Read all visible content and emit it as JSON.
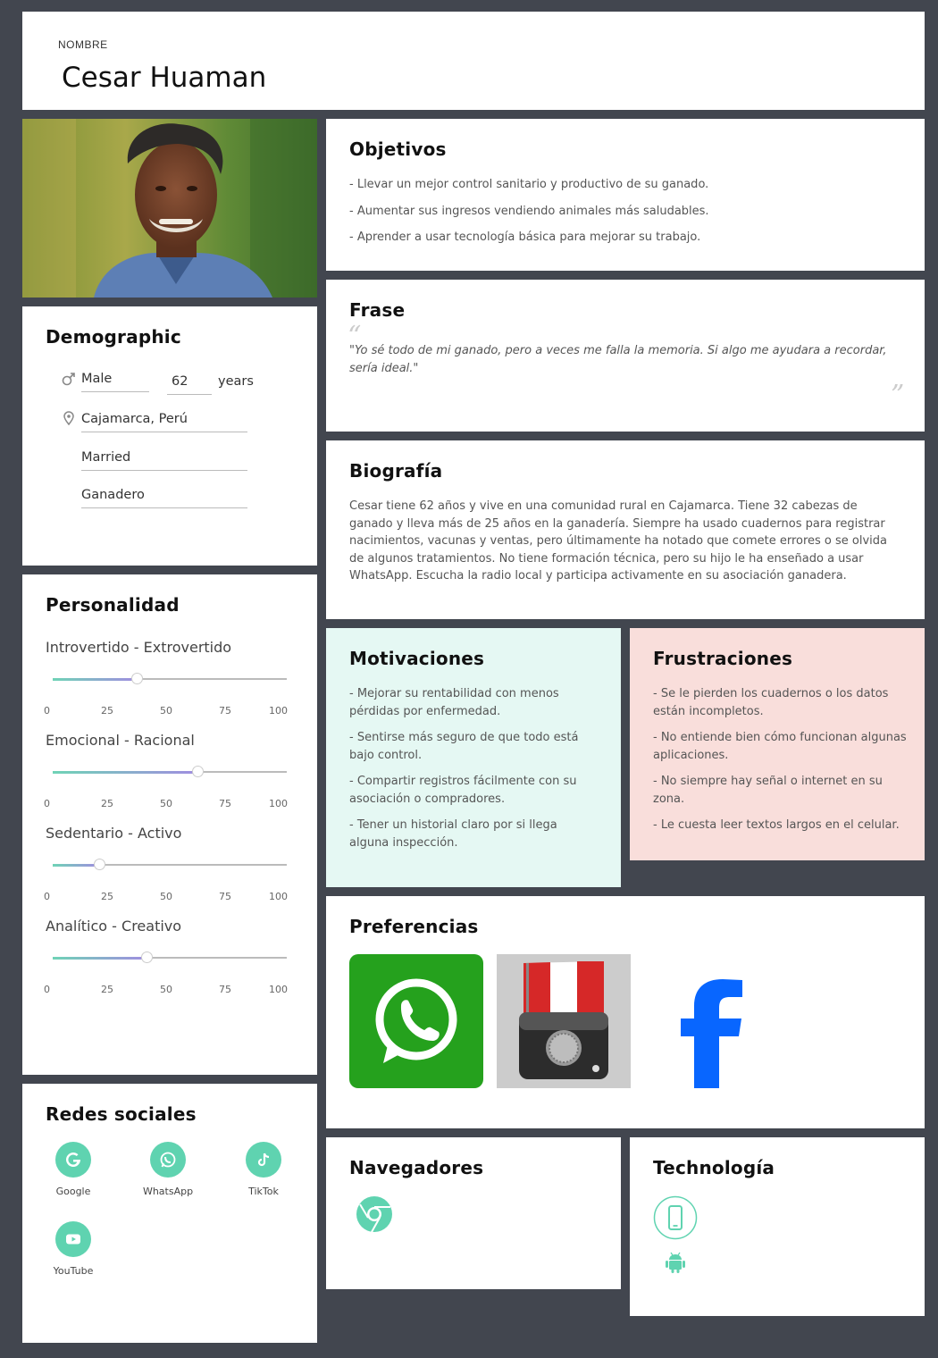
{
  "header": {
    "label": "NOMBRE",
    "name": "Cesar Huaman"
  },
  "demographic": {
    "title": "Demographic",
    "gender": "Male",
    "age": "62",
    "age_unit": "years",
    "location": "Cajamarca, Perú",
    "status": "Married",
    "occupation": "Ganadero"
  },
  "personality": {
    "title": "Personalidad",
    "ticks": [
      "0",
      "25",
      "50",
      "75",
      "100"
    ],
    "traits": [
      {
        "label": "Introvertido - Extrovertido",
        "value": 36
      },
      {
        "label": "Emocional - Racional",
        "value": 62
      },
      {
        "label": "Sedentario - Activo",
        "value": 20
      },
      {
        "label": "Analítico - Creativo",
        "value": 40
      }
    ]
  },
  "social": {
    "title": "Redes sociales",
    "items": [
      "Google",
      "WhatsApp",
      "TikTok",
      "YouTube"
    ]
  },
  "objectives": {
    "title": "Objetivos",
    "items": [
      "- Llevar un mejor control sanitario y productivo de su ganado.",
      "- Aumentar sus ingresos vendiendo animales más saludables.",
      "- Aprender a usar tecnología básica para mejorar su trabajo."
    ]
  },
  "quote": {
    "title": "Frase",
    "text": "\"Yo sé todo de mi ganado, pero a veces me falla la memoria. Si algo me ayudara a recordar, sería ideal.\""
  },
  "bio": {
    "title": "Biografía",
    "text": "Cesar tiene 62 años y vive en una comunidad rural en Cajamarca. Tiene 32 cabezas de ganado y lleva más de 25 años en la ganadería. Siempre ha usado cuadernos para registrar nacimientos, vacunas y ventas, pero últimamente ha notado que comete errores o se olvida de algunos tratamientos. No tiene formación técnica, pero su hijo le ha enseñado a usar WhatsApp. Escucha la radio local y participa activamente en su asociación ganadera."
  },
  "motivations": {
    "title": "Motivaciones",
    "items": [
      "- Mejorar su rentabilidad con menos pérdidas por enfermedad.",
      "- Sentirse más seguro de que todo está bajo control.",
      "- Compartir registros fácilmente con su asociación o compradores.",
      "- Tener un historial claro por si llega alguna inspección."
    ]
  },
  "frustrations": {
    "title": "Frustraciones",
    "items": [
      "- Se le pierden los cuadernos o los datos están incompletos.",
      "- No entiende bien cómo funcionan algunas aplicaciones.",
      "- No siempre hay señal o internet en su zona.",
      "- Le cuesta leer textos largos en el celular."
    ]
  },
  "preferences": {
    "title": "Preferencias"
  },
  "browsers": {
    "title": "Navegadores"
  },
  "technology": {
    "title": "Technología"
  },
  "colors": {
    "accent": "#5fd3b0",
    "background": "#42464f",
    "motivations_bg": "#e5f8f3",
    "frustrations_bg": "#f9dedb"
  }
}
